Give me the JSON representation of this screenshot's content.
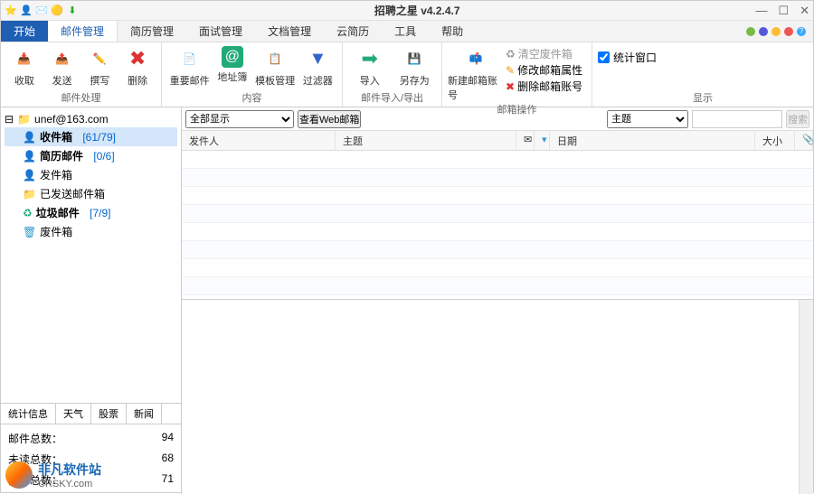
{
  "title": "招聘之星 v4.2.4.7",
  "menu": {
    "start": "开始",
    "tabs": [
      "邮件管理",
      "简历管理",
      "面试管理",
      "文档管理",
      "云简历",
      "工具",
      "帮助"
    ]
  },
  "ribbon": {
    "g1": {
      "name": "邮件处理",
      "items": [
        "收取",
        "发送",
        "撰写",
        "删除"
      ]
    },
    "g2": {
      "name": "内容",
      "items": [
        "重要邮件",
        "地址簿",
        "模板管理",
        "过滤器"
      ]
    },
    "g3": {
      "name": "邮件导入/导出",
      "items": [
        "导入",
        "另存为"
      ]
    },
    "g4": {
      "name": "邮箱操作",
      "new": "新建邮箱账号",
      "clear": "清空废件箱",
      "edit": "修改邮箱属性",
      "del": "删除邮箱账号"
    },
    "g5": {
      "name": "显示",
      "chk": "统计窗口"
    }
  },
  "tree": {
    "account": "unef@163.com",
    "items": [
      {
        "label": "收件箱",
        "count": "[61/79]"
      },
      {
        "label": "简历邮件",
        "count": "[0/6]"
      },
      {
        "label": "发件箱",
        "count": ""
      },
      {
        "label": "已发送邮件箱",
        "count": ""
      },
      {
        "label": "垃圾邮件",
        "count": "[7/9]"
      },
      {
        "label": "废件箱",
        "count": ""
      }
    ]
  },
  "tabs2": [
    "统计信息",
    "天气",
    "股票",
    "新闻"
  ],
  "stats": [
    {
      "label": "邮件总数：",
      "value": "94"
    },
    {
      "label": "未读总数：",
      "value": "68"
    },
    {
      "label": "简历总数：",
      "value": "71"
    }
  ],
  "filter": {
    "all": "全部显示",
    "viewweb": "查看Web邮箱",
    "subject": "主题",
    "search": "搜索"
  },
  "cols": {
    "sender": "发件人",
    "subject": "主题",
    "date": "日期",
    "size": "大小"
  },
  "wm": {
    "t1": "非凡软件站",
    "t2": "CRSKY.com"
  }
}
